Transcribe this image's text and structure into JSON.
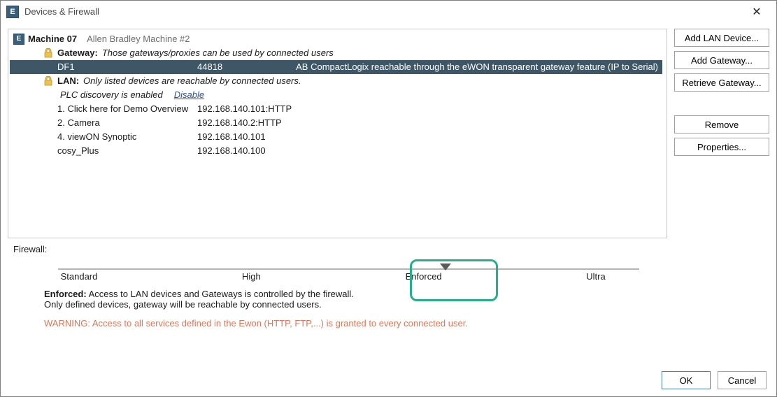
{
  "window": {
    "title": "Devices & Firewall",
    "app_icon_letter": "E"
  },
  "sidebar": {
    "add_lan": "Add LAN Device...",
    "add_gateway": "Add Gateway...",
    "retrieve_gateway": "Retrieve Gateway...",
    "remove": "Remove",
    "properties": "Properties..."
  },
  "tree": {
    "root": {
      "name": "Machine 07",
      "subtitle": "Allen Bradley Machine #2"
    },
    "gateway": {
      "label": "Gateway:",
      "note": "Those gateways/proxies can be used by connected users",
      "items": [
        {
          "name": "DF1",
          "port": "44818",
          "desc": "AB CompactLogix reachable through the eWON transparent gateway feature (IP to Serial)",
          "selected": true
        }
      ]
    },
    "lan": {
      "label": "LAN:",
      "note": "Only listed devices are reachable by connected users.",
      "discovery_text": "PLC discovery is enabled",
      "disable_link": "Disable",
      "items": [
        {
          "name": "1. Click here for Demo Overview",
          "addr": "192.168.140.101:HTTP"
        },
        {
          "name": "2. Camera",
          "addr": "192.168.140.2:HTTP"
        },
        {
          "name": "4. viewON Synoptic",
          "addr": "192.168.140.101"
        },
        {
          "name": "cosy_Plus",
          "addr": "192.168.140.100"
        }
      ]
    }
  },
  "firewall": {
    "section_title": "Firewall:",
    "levels": [
      "Standard",
      "High",
      "Enforced",
      "Ultra"
    ],
    "current_index": 2,
    "desc_title": "Enforced:",
    "desc_line1": "Access to LAN devices and Gateways is controlled by the firewall.",
    "desc_line2": "Only defined devices, gateway will be reachable by connected users.",
    "warning": "WARNING: Access to all services defined in the Ewon (HTTP, FTP,...) is granted to every connected user."
  },
  "footer": {
    "ok": "OK",
    "cancel": "Cancel"
  }
}
